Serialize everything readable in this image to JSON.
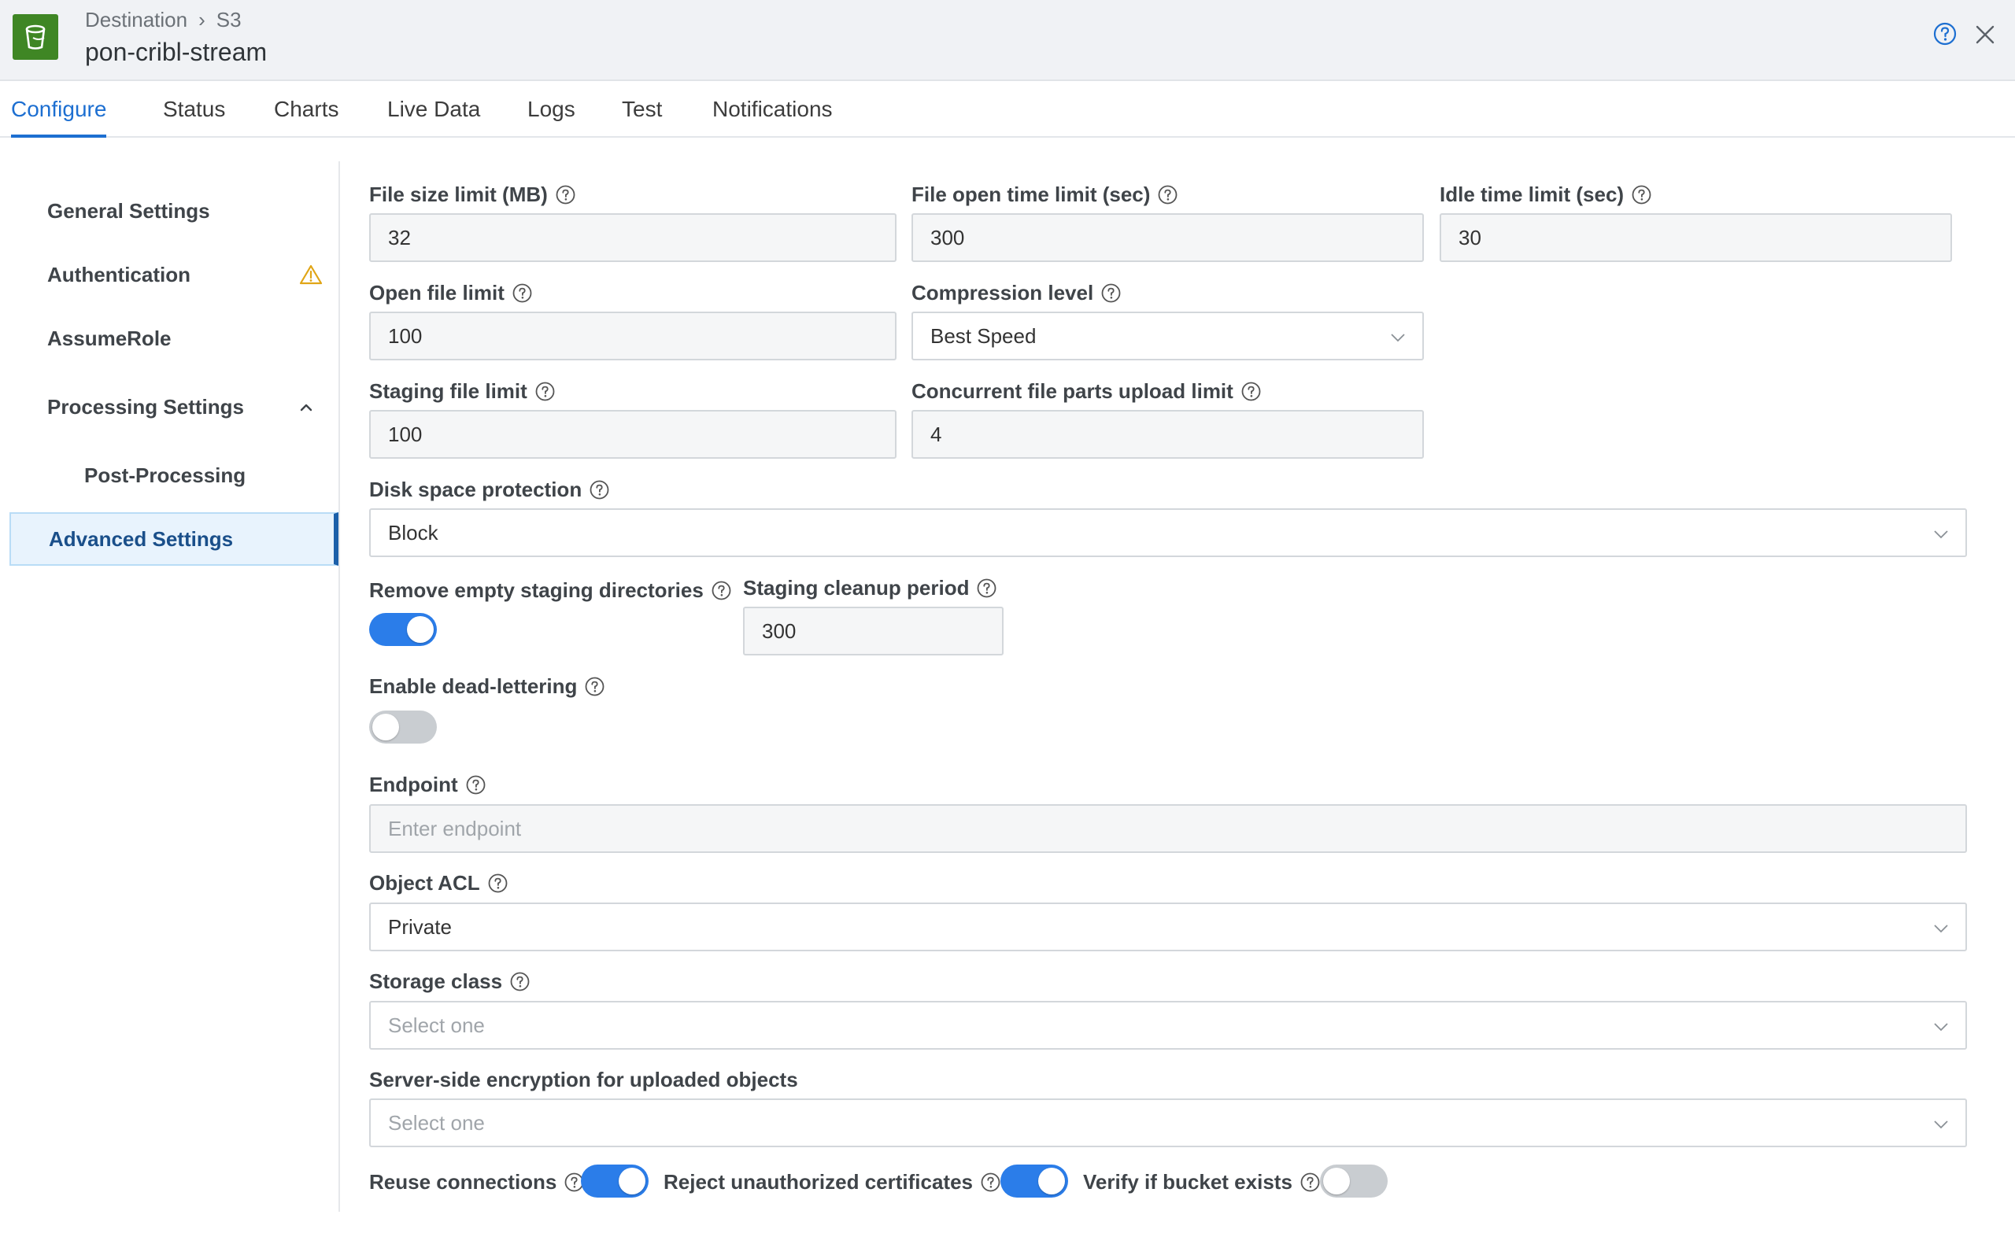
{
  "header": {
    "breadcrumb": [
      "Destination",
      "S3"
    ],
    "breadcrumb_separator": "›",
    "destination_name": "pon-cribl-stream",
    "logo_icon": "s3-bucket-icon",
    "colors": {
      "logo": "#3f8624",
      "accent": "#1d6fd1"
    }
  },
  "tabs": [
    {
      "label": "Configure",
      "active": true
    },
    {
      "label": "Status"
    },
    {
      "label": "Charts"
    },
    {
      "label": "Live Data"
    },
    {
      "label": "Logs"
    },
    {
      "label": "Test"
    },
    {
      "label": "Notifications"
    }
  ],
  "sidebar": {
    "items": [
      {
        "label": "General Settings"
      },
      {
        "label": "Authentication",
        "icon": "warning-icon"
      },
      {
        "label": "AssumeRole"
      },
      {
        "label": "Processing Settings",
        "icon": "chevron-up-icon",
        "expanded": true
      },
      {
        "label": "Post-Processing",
        "sub": true
      },
      {
        "label": "Advanced Settings",
        "active": true
      }
    ]
  },
  "form": {
    "file_size_limit": {
      "label": "File size limit (MB)",
      "value": "32"
    },
    "file_open_time_limit": {
      "label": "File open time limit (sec)",
      "value": "300"
    },
    "idle_time_limit": {
      "label": "Idle time limit (sec)",
      "value": "30"
    },
    "open_file_limit": {
      "label": "Open file limit",
      "value": "100"
    },
    "compression_level": {
      "label": "Compression level",
      "value": "Best Speed"
    },
    "staging_file_limit": {
      "label": "Staging file limit",
      "value": "100"
    },
    "concurrent_upload_limit": {
      "label": "Concurrent file parts upload limit",
      "value": "4"
    },
    "disk_space_protection": {
      "label": "Disk space protection",
      "value": "Block"
    },
    "remove_empty_staging": {
      "label": "Remove empty staging directories",
      "enabled": true
    },
    "staging_cleanup_period": {
      "label": "Staging cleanup period",
      "value": "300"
    },
    "dead_lettering": {
      "label": "Enable dead-lettering",
      "enabled": false
    },
    "endpoint": {
      "label": "Endpoint",
      "value": "",
      "placeholder": "Enter endpoint"
    },
    "object_acl": {
      "label": "Object ACL",
      "value": "Private"
    },
    "storage_class": {
      "label": "Storage class",
      "placeholder": "Select one"
    },
    "server_side_encryption": {
      "label": "Server-side encryption for uploaded objects",
      "placeholder": "Select one"
    },
    "reuse_connections": {
      "label": "Reuse connections",
      "enabled": true
    },
    "reject_unauthorized": {
      "label": "Reject unauthorized certificates",
      "enabled": true
    },
    "verify_bucket": {
      "label": "Verify if bucket exists",
      "enabled": false
    }
  }
}
